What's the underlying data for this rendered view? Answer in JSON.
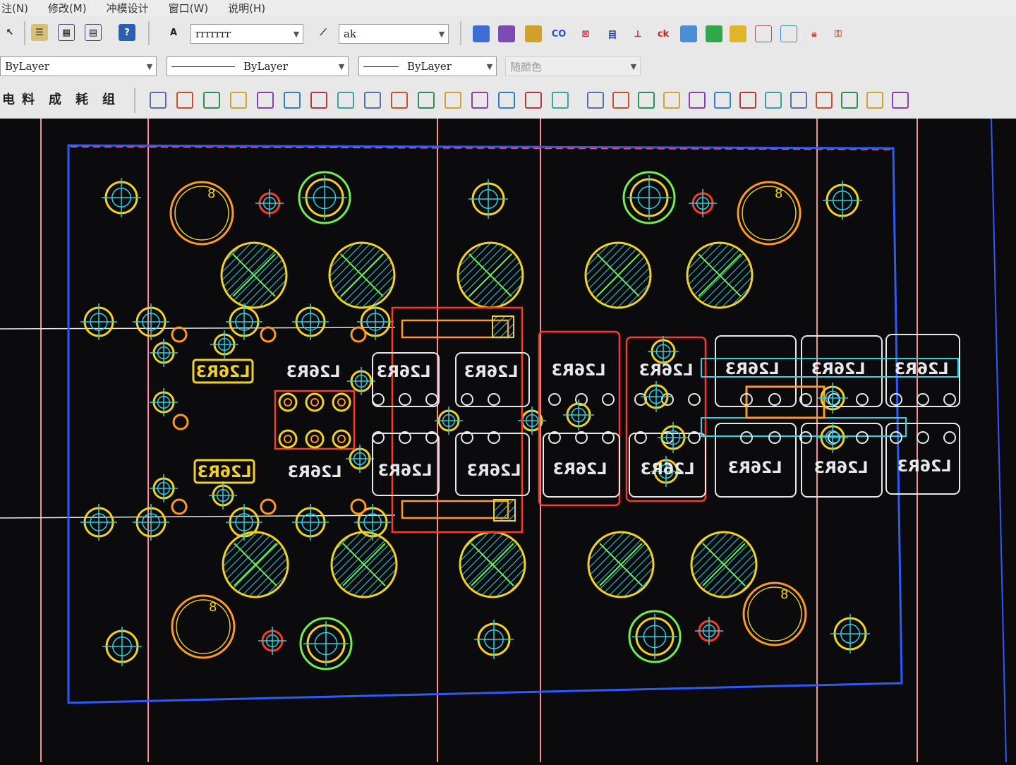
{
  "menu": [
    "注(N)",
    "修改(M)",
    "冲模设计",
    "窗口(W)",
    "说明(H)"
  ],
  "toolbar": {
    "text_style": "rrrrrrr",
    "dim_style": "ak",
    "layer": "ByLayer",
    "linetype": "ByLayer",
    "lineweight": "ByLayer",
    "color": "随颜色",
    "mold_tools": [
      "料",
      "成",
      "耗",
      "组"
    ]
  },
  "drawing": {
    "part_labels": [
      "L26R3",
      "L26R3",
      "L26R3",
      "L26R3",
      "L26R3",
      "L26R3",
      "L26R3",
      "L26R3",
      "L26R3",
      "L26R3",
      "L26R3",
      "L26R3",
      "L26R3",
      "L26R3",
      "L26R3",
      "L26R3",
      "L26R3",
      "L26R3"
    ],
    "tiny_label": "8",
    "colors": {
      "frame": "#2b5bff",
      "hole_yellow": "#f2d21a",
      "hole_orange": "#ff9a1a",
      "hatch_cyan": "#23d6e8",
      "hatch_green": "#6ff04a",
      "outline_red": "#ff3a22",
      "outline_white": "#e8e8e8",
      "guide_pink": "#ff8a9a",
      "background": "#0b0b0d"
    }
  }
}
